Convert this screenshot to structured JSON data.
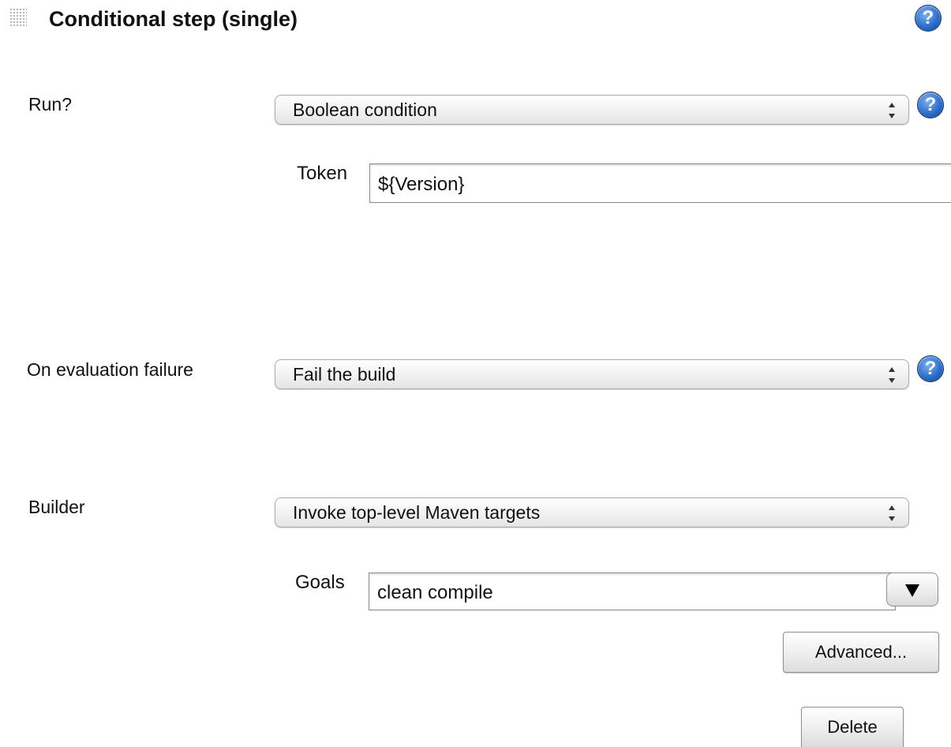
{
  "header": {
    "title": "Conditional step (single)",
    "help_glyph": "?"
  },
  "run": {
    "label": "Run?",
    "selected": "Boolean condition",
    "token_label": "Token",
    "token_value": "${Version}"
  },
  "on_failure": {
    "label": "On evaluation failure",
    "selected": "Fail the build"
  },
  "builder": {
    "label": "Builder",
    "selected": "Invoke top-level Maven targets",
    "goals_label": "Goals",
    "goals_value": "clean compile",
    "advanced_label": "Advanced...",
    "delete_label": "Delete"
  },
  "icons": [
    "drag-handle-icon",
    "help-icon",
    "select-arrows-icon",
    "dropdown-triangle-icon"
  ],
  "colors": {
    "help_blue": "#2d6fce",
    "text": "#111111",
    "border": "#a9a9a9"
  }
}
